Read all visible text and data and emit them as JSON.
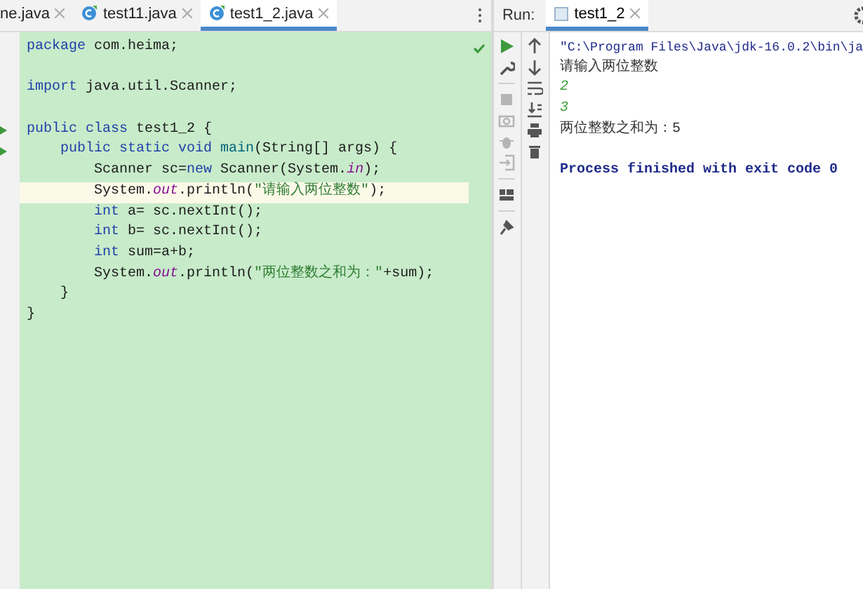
{
  "editor": {
    "tabs": [
      {
        "label": "ne.java",
        "selected": false,
        "icon": false
      },
      {
        "label": "test11.java",
        "selected": false,
        "icon": true
      },
      {
        "label": "test1_2.java",
        "selected": true,
        "icon": true
      }
    ],
    "lines": [
      {
        "run_marker": false,
        "current": false,
        "tokens": [
          {
            "kind": "keyword",
            "text": "package"
          },
          {
            "kind": "plain",
            "text": " com.heima;"
          }
        ]
      },
      {
        "kind": "blank"
      },
      {
        "run_marker": false,
        "current": false,
        "tokens": [
          {
            "kind": "keyword",
            "text": "import"
          },
          {
            "kind": "plain",
            "text": " java.util.Scanner;"
          }
        ]
      },
      {
        "kind": "blank"
      },
      {
        "run_marker": true,
        "current": false,
        "tokens": [
          {
            "kind": "keyword",
            "text": "public class"
          },
          {
            "kind": "plain",
            "text": " test1_2 {"
          }
        ]
      },
      {
        "run_marker": true,
        "current": false,
        "tokens": [
          {
            "kind": "keyword",
            "text": "    public static void "
          },
          {
            "kind": "method",
            "text": "main"
          },
          {
            "kind": "plain",
            "text": "(String[] args) {"
          }
        ]
      },
      {
        "run_marker": false,
        "current": false,
        "tokens": [
          {
            "kind": "plain",
            "text": "        Scanner sc="
          },
          {
            "kind": "keyword",
            "text": "new"
          },
          {
            "kind": "plain",
            "text": " Scanner(System."
          },
          {
            "kind": "field",
            "text": "in"
          },
          {
            "kind": "plain",
            "text": ");"
          }
        ]
      },
      {
        "run_marker": false,
        "current": true,
        "tokens": [
          {
            "kind": "plain",
            "text": "        System."
          },
          {
            "kind": "field",
            "text": "out"
          },
          {
            "kind": "plain",
            "text": ".println("
          },
          {
            "kind": "string",
            "text": "\"请输入两位整数\""
          },
          {
            "kind": "plain",
            "text": ");"
          }
        ]
      },
      {
        "run_marker": false,
        "current": false,
        "tokens": [
          {
            "kind": "keyword",
            "text": "        int"
          },
          {
            "kind": "plain",
            "text": " a= sc.nextInt();"
          }
        ]
      },
      {
        "run_marker": false,
        "current": false,
        "tokens": [
          {
            "kind": "keyword",
            "text": "        int"
          },
          {
            "kind": "plain",
            "text": " b= sc.nextInt();"
          }
        ]
      },
      {
        "run_marker": false,
        "current": false,
        "tokens": [
          {
            "kind": "keyword",
            "text": "        int"
          },
          {
            "kind": "plain",
            "text": " sum=a+b;"
          }
        ]
      },
      {
        "run_marker": false,
        "current": false,
        "tokens": [
          {
            "kind": "plain",
            "text": "        System."
          },
          {
            "kind": "field",
            "text": "out"
          },
          {
            "kind": "plain",
            "text": ".println("
          },
          {
            "kind": "string",
            "text": "\"两位整数之和为：\""
          },
          {
            "kind": "plain",
            "text": "+sum);"
          }
        ]
      },
      {
        "run_marker": false,
        "current": false,
        "tokens": [
          {
            "kind": "plain",
            "text": "    }"
          }
        ]
      },
      {
        "run_marker": false,
        "current": false,
        "tokens": [
          {
            "kind": "plain",
            "text": "}"
          }
        ]
      }
    ]
  },
  "run": {
    "label": "Run:",
    "tab": "test1_2",
    "console": [
      {
        "kind": "command",
        "text": "\"C:\\Program Files\\Java\\jdk-16.0.2\\bin\\ja"
      },
      {
        "kind": "output",
        "text": "请输入两位整数"
      },
      {
        "kind": "input",
        "text": "2"
      },
      {
        "kind": "input",
        "text": "3"
      },
      {
        "kind": "output",
        "text": "两位整数之和为：5"
      },
      {
        "kind": "blank"
      },
      {
        "kind": "status",
        "text": "Process finished with exit code 0"
      }
    ]
  }
}
